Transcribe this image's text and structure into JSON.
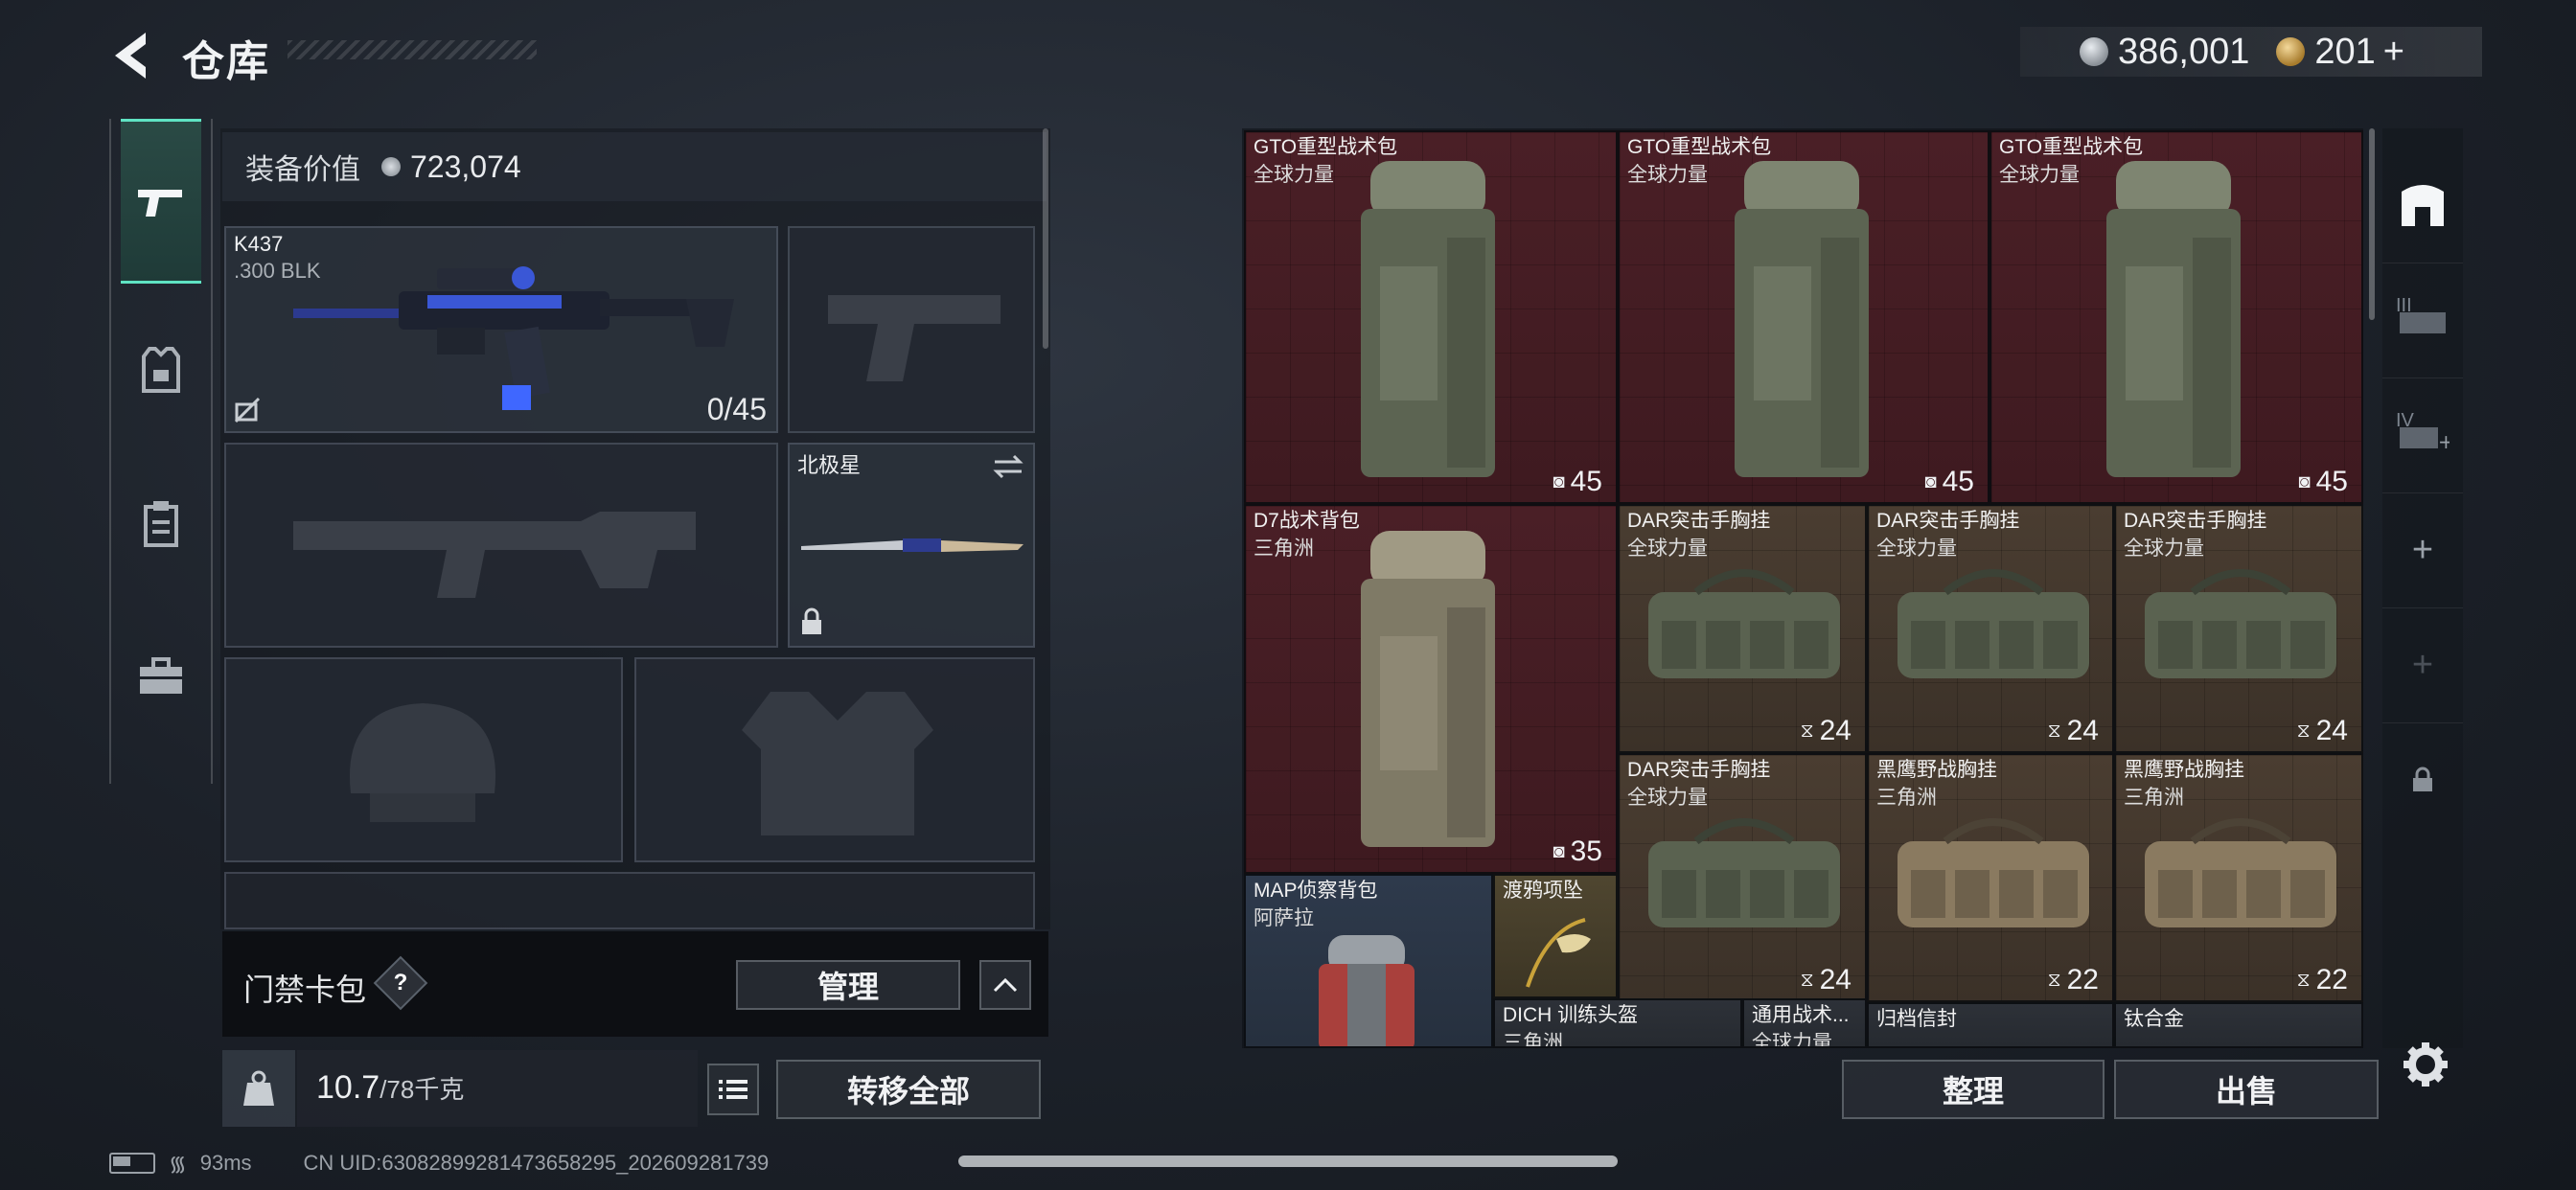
{
  "header": {
    "title": "仓库"
  },
  "currency": {
    "silver": "386,001",
    "gold": "201",
    "gold_plus": "+"
  },
  "categories": [
    "weapons",
    "armor",
    "clipboard",
    "briefcase"
  ],
  "equipment": {
    "value_label": "装备价值",
    "value": "723,074",
    "primary_weapon": {
      "name": "K437",
      "ammo_type": ".300 BLK",
      "ammo": "0/45"
    },
    "melee": {
      "name": "北极星"
    }
  },
  "keycard": {
    "label": "门禁卡包",
    "help": "?",
    "manage": "管理"
  },
  "weight": {
    "current": "10.7",
    "max": "/78千克"
  },
  "transfer_all": "转移全部",
  "inventory": [
    {
      "name": "GTO重型战术包",
      "sub": "全球力量",
      "cap": "45"
    },
    {
      "name": "GTO重型战术包",
      "sub": "全球力量",
      "cap": "45"
    },
    {
      "name": "GTO重型战术包",
      "sub": "全球力量",
      "cap": "45"
    },
    {
      "name": "D7战术背包",
      "sub": "三角洲",
      "cap": "35"
    },
    {
      "name": "DAR突击手胸挂",
      "sub": "全球力量",
      "cap": "24"
    },
    {
      "name": "DAR突击手胸挂",
      "sub": "全球力量",
      "cap": "24"
    },
    {
      "name": "DAR突击手胸挂",
      "sub": "全球力量",
      "cap": "24"
    },
    {
      "name": "DAR突击手胸挂",
      "sub": "全球力量",
      "cap": "24"
    },
    {
      "name": "黑鹰野战胸挂",
      "sub": "三角洲",
      "cap": "22"
    },
    {
      "name": "黑鹰野战胸挂",
      "sub": "三角洲",
      "cap": "22"
    },
    {
      "name": "MAP侦察背包",
      "sub": "阿萨拉"
    },
    {
      "name": "渡鸦项坠"
    },
    {
      "name": "DICH 训练头盔",
      "sub": "三角洲"
    },
    {
      "name": "通用战术...",
      "sub": "全球力量"
    },
    {
      "name": "归档信封"
    },
    {
      "name": "钛合金"
    }
  ],
  "sidebar_right": {
    "tier3": "III",
    "tier4": "IV",
    "add": "+",
    "lock": "lock-icon"
  },
  "actions": {
    "organize": "整理",
    "sell": "出售"
  },
  "status_bar": {
    "ping": "93ms",
    "uid": "CN UID:6308289928147365829​5_202609281739"
  },
  "colors": {
    "accent": "#5fe3c3",
    "red_slot": "#4a1f26",
    "brown_slot": "#4a3d31"
  }
}
